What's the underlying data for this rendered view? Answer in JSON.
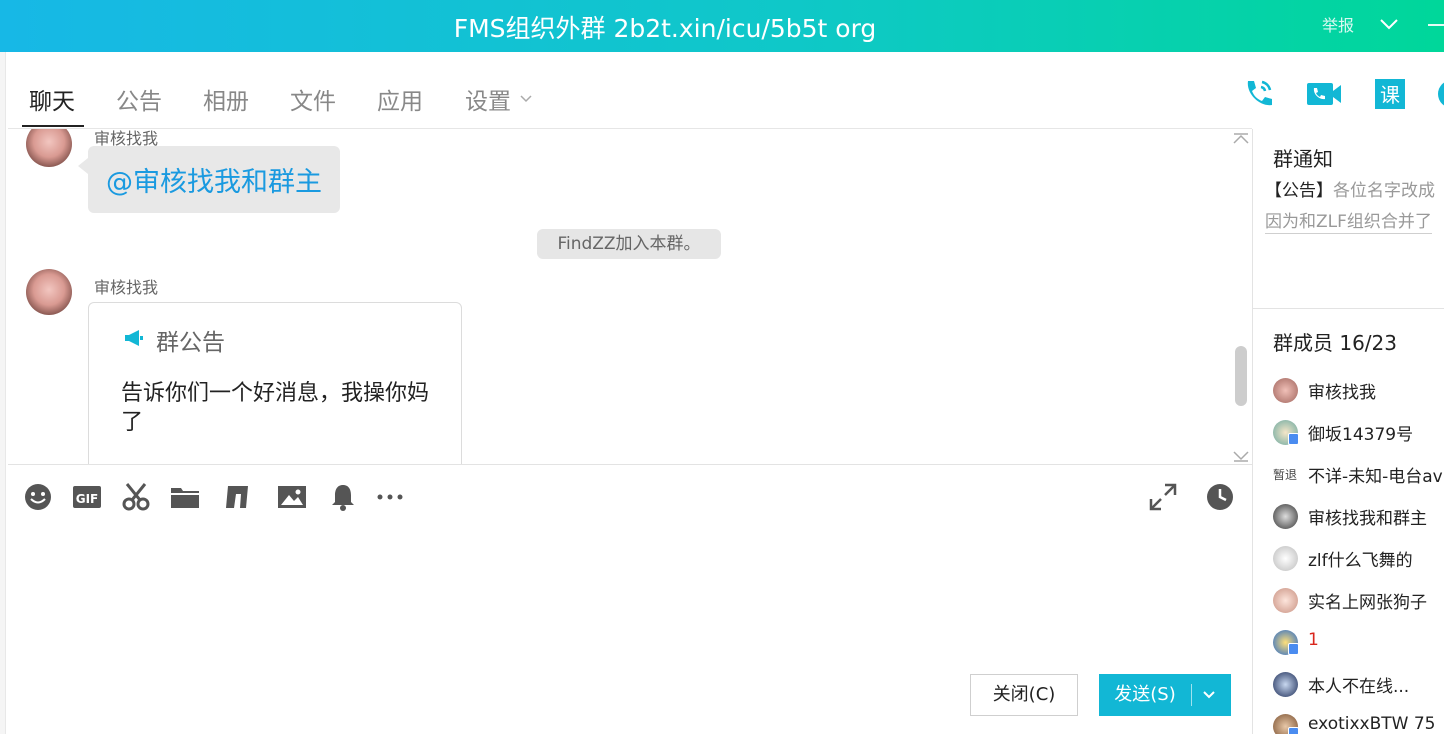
{
  "window": {
    "title": "FMS组织外群 2b2t.xin/icu/5b5t org",
    "report_label": "举报"
  },
  "tabs": [
    {
      "label": "聊天"
    },
    {
      "label": "公告"
    },
    {
      "label": "相册"
    },
    {
      "label": "文件"
    },
    {
      "label": "应用"
    },
    {
      "label": "设置"
    }
  ],
  "header_icons": [
    "phone-icon",
    "video-call-icon",
    "class-icon"
  ],
  "messages": {
    "msg1": {
      "sender": "审核找我",
      "text": "@审核找我和群主"
    },
    "system": {
      "text": "FindZZ加入本群。"
    },
    "msg2": {
      "sender": "审核找我",
      "announcement_title": "群公告",
      "announcement_body": "告诉你们一个好消息，我操你妈了"
    }
  },
  "toolbar": [
    "emoji-icon",
    "gif-icon",
    "scissors-icon",
    "folder-icon",
    "shake-icon",
    "image-icon",
    "bell-icon",
    "more-icon",
    "expand-icon",
    "history-icon"
  ],
  "buttons": {
    "close_label": "关闭(C)",
    "send_label": "发送(S)"
  },
  "right_panel": {
    "notice_title": "群通知",
    "notice_prefix": "【公告】",
    "notice_text": "各位名字改成",
    "notice_line2": "因为和ZLF组织合并了",
    "members_title": "群成员 16/23",
    "members": [
      {
        "name": "审核找我"
      },
      {
        "name": "御坂14379号"
      },
      {
        "name": "不详-未知-电台av",
        "tag": "暂退"
      },
      {
        "name": "审核找我和群主"
      },
      {
        "name": "zlf什么飞舞的"
      },
      {
        "name": "实名上网张狗子"
      },
      {
        "name": "1",
        "color": "#d9261c"
      },
      {
        "name": "本人不在线..."
      },
      {
        "name": "exotixxBTW 75"
      }
    ]
  },
  "colors": {
    "titlebar_start": "#17b8e6",
    "titlebar_end": "#00d79a",
    "accent": "#12b7d5",
    "mention": "#1a9ae0"
  }
}
